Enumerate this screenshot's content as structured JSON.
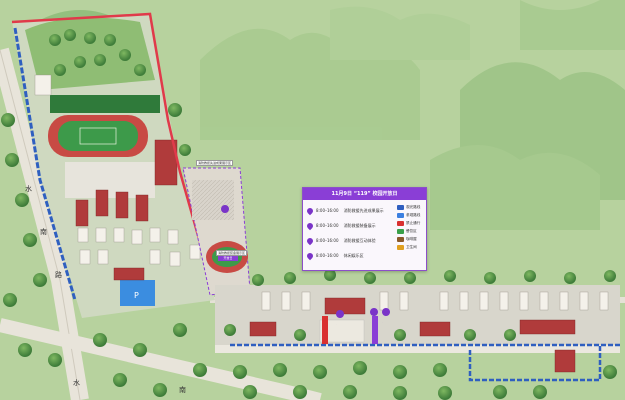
{
  "panel": {
    "title": "11月9日 “119” 校园开放日",
    "events": [
      {
        "time": "8:00–16:00",
        "name": "消防救援先进成果展示"
      },
      {
        "time": "8:00–16:00",
        "name": "消防救援装备展示"
      },
      {
        "time": "8:00–16:00",
        "name": "消防救援互动体验"
      },
      {
        "time": "8:00–16:00",
        "name": "休闲娱乐区"
      }
    ],
    "legend": [
      {
        "label": "观光路线",
        "color": "#2f5fc0"
      },
      {
        "label": "参观路线",
        "color": "#3b7fe0"
      },
      {
        "label": "禁止通行",
        "color": "#d93030"
      },
      {
        "label": "餐饮区",
        "color": "#3aa04a"
      },
      {
        "label": "咖啡屋",
        "color": "#8a5a2a"
      },
      {
        "label": "卫生间",
        "color": "#e0a020"
      }
    ]
  },
  "road_labels": {
    "left_road": [
      "水",
      "南",
      "路"
    ],
    "bottom_road": [
      "水",
      "南"
    ]
  },
  "building_tags": [
    "消防救援先进成果展示区",
    "消防救援装备展示区"
  ],
  "colors": {
    "campus_outline": "#e03a4a",
    "tour_route": "#2f5fc0",
    "event_purple": "#8a3ed6",
    "track": "#c84a44",
    "field": "#3d9a4a"
  }
}
